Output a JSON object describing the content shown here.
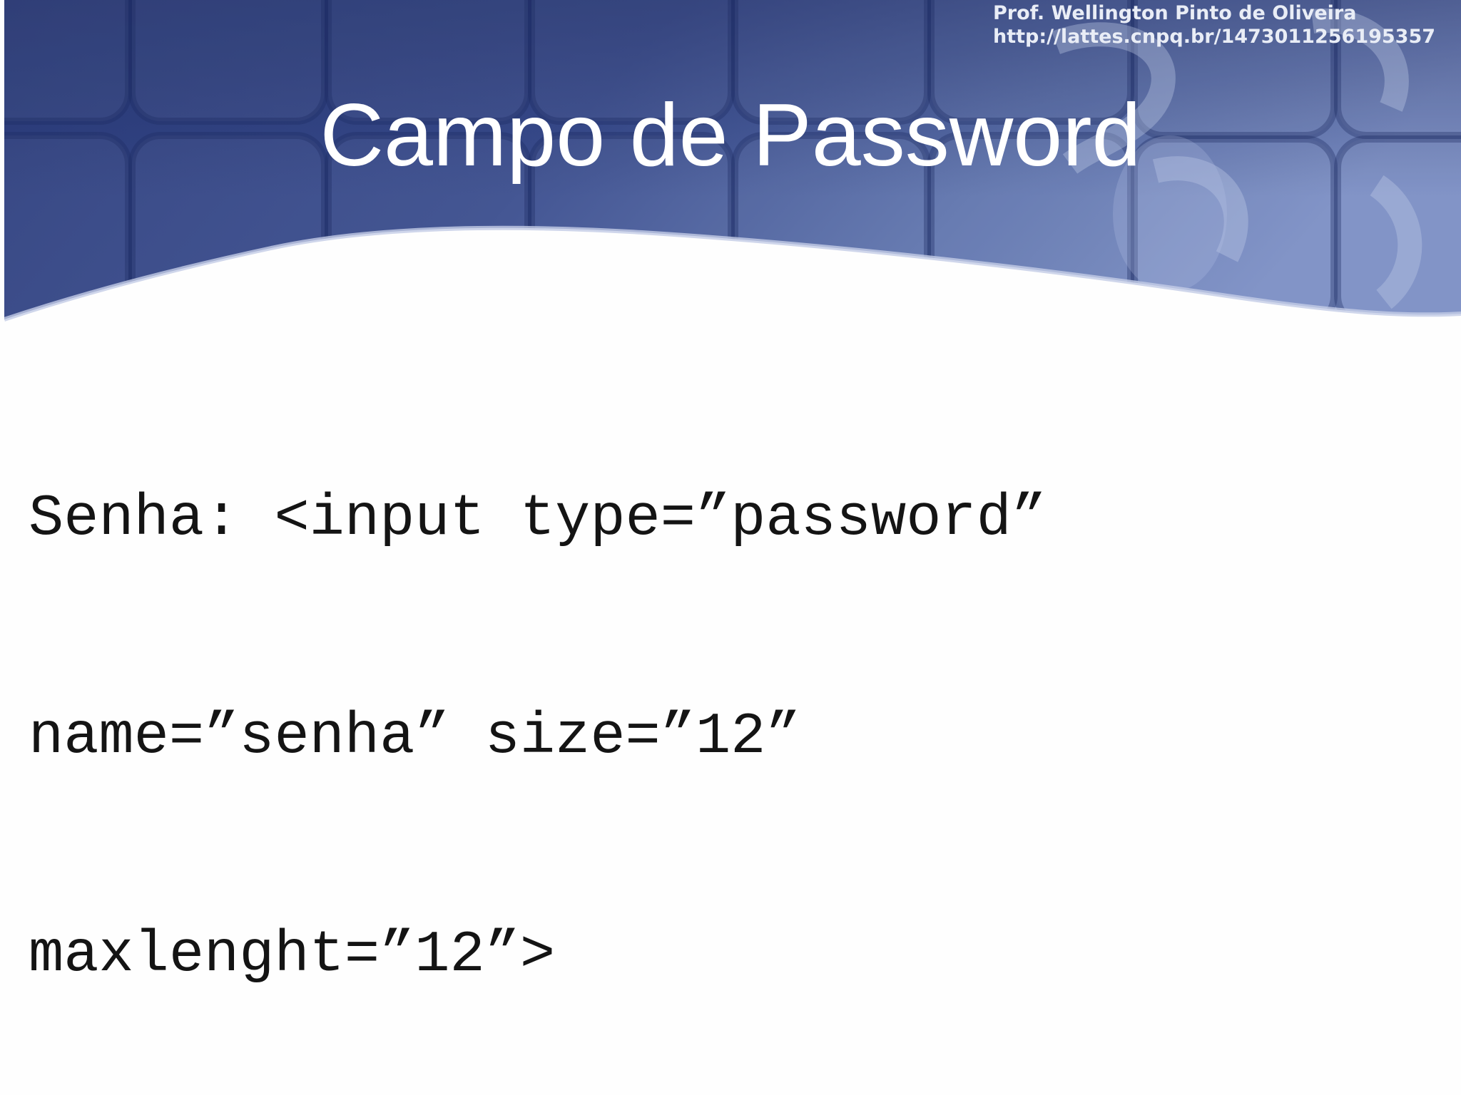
{
  "header": {
    "author": "Prof. Wellington Pinto de Oliveira",
    "url": "http://lattes.cnpq.br/1473011256195357"
  },
  "slide": {
    "title": "Campo de Password",
    "code_lines": [
      "Senha: <input type=”password”",
      "name=”senha” size=”12”",
      "maxlenght=”12”>"
    ]
  },
  "colors": {
    "banner_dark": "#2e3f7e",
    "banner_light": "#8a9ccc",
    "background": "#fefefe",
    "title_text": "#ffffff",
    "body_text": "#141414"
  }
}
